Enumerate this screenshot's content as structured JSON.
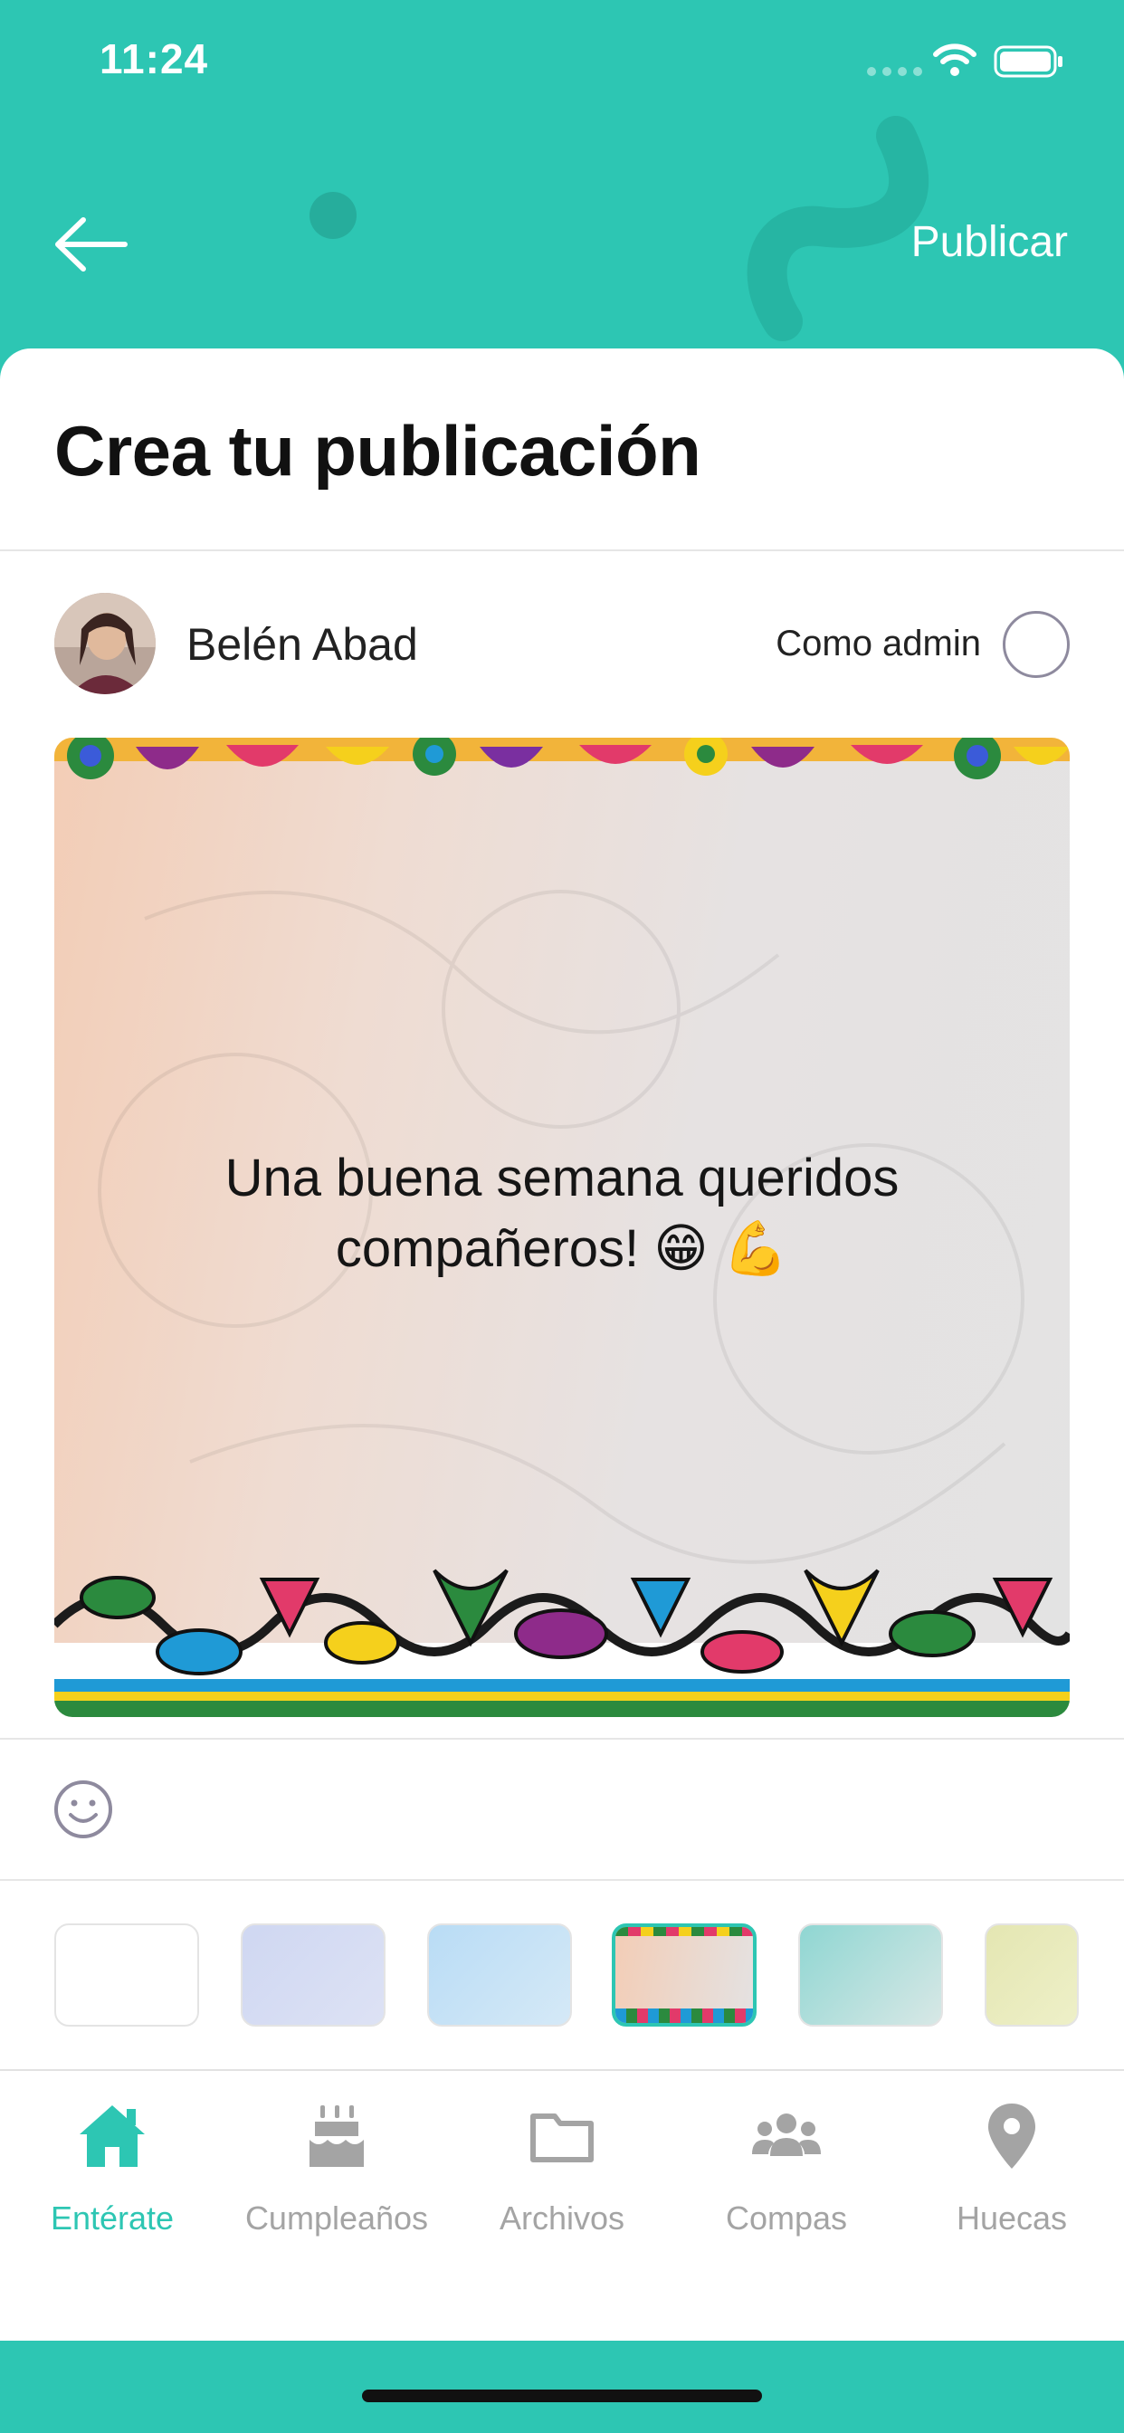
{
  "status_bar": {
    "time": "11:24"
  },
  "header": {
    "publish_label": "Publicar"
  },
  "main": {
    "title": "Crea tu publicación",
    "author": {
      "name": "Belén Abad"
    },
    "admin_toggle": {
      "label": "Como admin",
      "checked": false
    },
    "post": {
      "text": "Una buena semana queridos compañeros! 😁 💪"
    }
  },
  "tabs": [
    {
      "label": "Entérate",
      "icon": "home-icon",
      "active": true
    },
    {
      "label": "Cumpleaños",
      "icon": "birthday-cake-icon",
      "active": false
    },
    {
      "label": "Archivos",
      "icon": "folder-icon",
      "active": false
    },
    {
      "label": "Compas",
      "icon": "users-icon",
      "active": false
    },
    {
      "label": "Huecas",
      "icon": "location-pin-icon",
      "active": false
    }
  ],
  "colors": {
    "accent": "#2dc6b3",
    "inactive": "#a4a4a4",
    "text": "#111111"
  }
}
